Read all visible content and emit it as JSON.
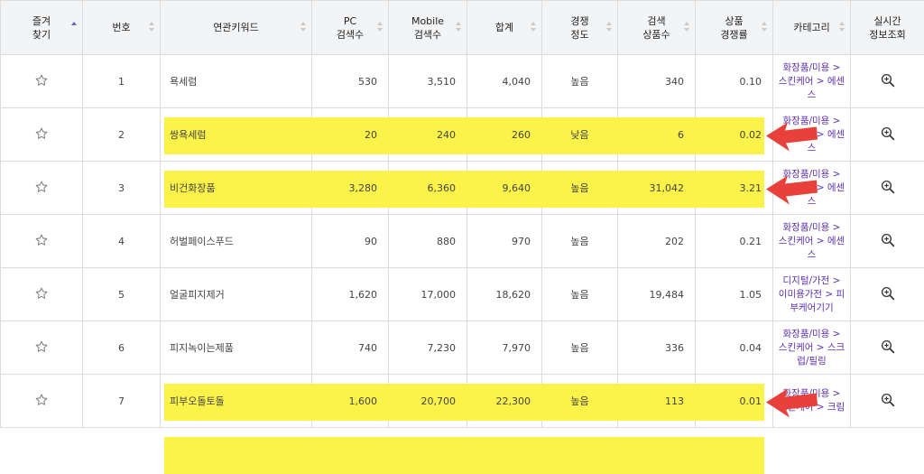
{
  "headers": {
    "favorite": "즐겨\n찾기",
    "number": "번호",
    "keyword": "연관키워드",
    "pc": "PC\n검색수",
    "mobile": "Mobile\n검색수",
    "total": "합계",
    "competition": "경쟁\n정도",
    "products": "검색\n상품수",
    "product_competition": "상품\n경쟁률",
    "category": "카테고리",
    "realtime": "실시간\n정보조회"
  },
  "rows": [
    {
      "no": "1",
      "keyword": "욕세럼",
      "pc": "530",
      "mobile": "3,510",
      "total": "4,040",
      "competition": "높음",
      "products": "340",
      "ratio": "0.10",
      "category": "화장품/미용 >\n스킨케어 > 에센\n스",
      "highlight": true
    },
    {
      "no": "2",
      "keyword": "쌍욕세럼",
      "pc": "20",
      "mobile": "240",
      "total": "260",
      "competition": "낮음",
      "products": "6",
      "ratio": "0.02",
      "category": "화장품/미용 >\n스킨케어 > 에센\n스",
      "highlight": true
    },
    {
      "no": "3",
      "keyword": "비건화장품",
      "pc": "3,280",
      "mobile": "6,360",
      "total": "9,640",
      "competition": "높음",
      "products": "31,042",
      "ratio": "3.21",
      "category": "화장품/미용 >\n스킨케어 > 에센\n스",
      "highlight": false
    },
    {
      "no": "4",
      "keyword": "허벌페이스푸드",
      "pc": "90",
      "mobile": "880",
      "total": "970",
      "competition": "높음",
      "products": "202",
      "ratio": "0.21",
      "category": "화장품/미용 >\n스킨케어 > 에센\n스",
      "highlight": false
    },
    {
      "no": "5",
      "keyword": "얼굴피지제거",
      "pc": "1,620",
      "mobile": "17,000",
      "total": "18,620",
      "competition": "높음",
      "products": "19,484",
      "ratio": "1.05",
      "category": "디지털/가전 >\n이미용가전 > 피\n부케어기기",
      "highlight": false
    },
    {
      "no": "6",
      "keyword": "피지녹이는제품",
      "pc": "740",
      "mobile": "7,230",
      "total": "7,970",
      "competition": "높음",
      "products": "336",
      "ratio": "0.04",
      "category": "화장품/미용 >\n스킨케어 > 스크\n럽/필링",
      "highlight": true
    },
    {
      "no": "7",
      "keyword": "피부오돌토돌",
      "pc": "1,600",
      "mobile": "20,700",
      "total": "22,300",
      "competition": "높음",
      "products": "113",
      "ratio": "0.01",
      "category": "화장품/미용 >\n스킨케어 > 크림",
      "highlight": true
    }
  ],
  "colors": {
    "highlight": "#fbf24a",
    "arrow": "#e8403a",
    "category_link": "#5b2fb0",
    "header_bg": "#f3f4f6"
  },
  "icons": {
    "favorite": "star-outline-icon",
    "realtime": "magnifier-plus-icon",
    "sort": "sort-arrows-icon",
    "annotation": "red-arrow-icon"
  }
}
